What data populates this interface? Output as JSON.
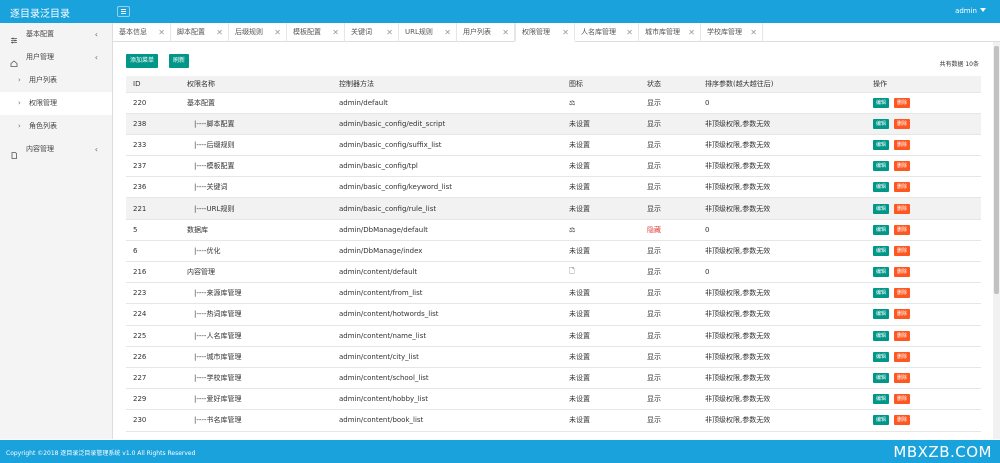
{
  "app": {
    "title": "逐目录泛目录",
    "user": "admin"
  },
  "sidebar": {
    "items": [
      {
        "label": "基本配置",
        "icon": "sliders-icon",
        "chev": "‹"
      },
      {
        "label": "用户管理",
        "icon": "home-icon",
        "chev": "‹"
      },
      {
        "label": "用户列表",
        "sub": true
      },
      {
        "label": "权限管理",
        "sub": true,
        "active": true
      },
      {
        "label": "角色列表",
        "sub": true
      },
      {
        "label": "内容管理",
        "icon": "document-icon",
        "chev": "‹"
      }
    ]
  },
  "tabs": [
    {
      "label": "基本信息",
      "close": "✕"
    },
    {
      "label": "脚本配置",
      "close": "✕"
    },
    {
      "label": "后缀规则",
      "close": "✕"
    },
    {
      "label": "模板配置",
      "close": "✕"
    },
    {
      "label": "关键词",
      "close": "✕"
    },
    {
      "label": "URL规则",
      "close": "✕"
    },
    {
      "label": "用户列表",
      "close": "✕"
    },
    {
      "label": "权限管理",
      "close": "✕",
      "active": true
    },
    {
      "label": "人名库管理",
      "close": "✕"
    },
    {
      "label": "城市库管理",
      "close": "✕"
    },
    {
      "label": "学校库管理",
      "close": "✕"
    }
  ],
  "toolbar": {
    "add_label": "添加菜单",
    "refresh_label": "刷新",
    "total": "共有数据 10条"
  },
  "table": {
    "headers": [
      "ID",
      "权限名称",
      "控制器方法",
      "图标",
      "状态",
      "排序参数(越大越往后)",
      "操作"
    ],
    "edit_label": "编辑",
    "delete_label": "删除",
    "rows": [
      {
        "id": "220",
        "name": "基本配置",
        "method": "admin/default",
        "icon": "⚖",
        "status": "显示",
        "sort": "0"
      },
      {
        "id": "238",
        "name": "|----脚本配置",
        "method": "admin/basic_config/edit_script",
        "icon": "未设置",
        "status": "显示",
        "sort": "非顶级权限,参数无效"
      },
      {
        "id": "233",
        "name": "|----后缀规则",
        "method": "admin/basic_config/suffix_list",
        "icon": "未设置",
        "status": "显示",
        "sort": "非顶级权限,参数无效"
      },
      {
        "id": "237",
        "name": "|----模板配置",
        "method": "admin/basic_config/tpl",
        "icon": "未设置",
        "status": "显示",
        "sort": "非顶级权限,参数无效"
      },
      {
        "id": "236",
        "name": "|----关键词",
        "method": "admin/basic_config/keyword_list",
        "icon": "未设置",
        "status": "显示",
        "sort": "非顶级权限,参数无效"
      },
      {
        "id": "221",
        "name": "|----URL规则",
        "method": "admin/basic_config/rule_list",
        "icon": "未设置",
        "status": "显示",
        "sort": "非顶级权限,参数无效"
      },
      {
        "id": "5",
        "name": "数据库",
        "method": "admin/DbManage/default",
        "icon": "⚖",
        "status": "隐藏",
        "sort": "0"
      },
      {
        "id": "6",
        "name": "|----优化",
        "method": "admin/DbManage/index",
        "icon": "未设置",
        "status": "显示",
        "sort": "非顶级权限,参数无效"
      },
      {
        "id": "216",
        "name": "内容管理",
        "method": "admin/content/default",
        "icon": "🗋",
        "status": "显示",
        "sort": "0"
      },
      {
        "id": "223",
        "name": "|----来源库管理",
        "method": "admin/content/from_list",
        "icon": "未设置",
        "status": "显示",
        "sort": "非顶级权限,参数无效"
      },
      {
        "id": "224",
        "name": "|----热词库管理",
        "method": "admin/content/hotwords_list",
        "icon": "未设置",
        "status": "显示",
        "sort": "非顶级权限,参数无效"
      },
      {
        "id": "225",
        "name": "|----人名库管理",
        "method": "admin/content/name_list",
        "icon": "未设置",
        "status": "显示",
        "sort": "非顶级权限,参数无效"
      },
      {
        "id": "226",
        "name": "|----城市库管理",
        "method": "admin/content/city_list",
        "icon": "未设置",
        "status": "显示",
        "sort": "非顶级权限,参数无效"
      },
      {
        "id": "227",
        "name": "|----学校库管理",
        "method": "admin/content/school_list",
        "icon": "未设置",
        "status": "显示",
        "sort": "非顶级权限,参数无效"
      },
      {
        "id": "229",
        "name": "|----爱好库管理",
        "method": "admin/content/hobby_list",
        "icon": "未设置",
        "status": "显示",
        "sort": "非顶级权限,参数无效"
      },
      {
        "id": "230",
        "name": "|----书名库管理",
        "method": "admin/content/book_list",
        "icon": "未设置",
        "status": "显示",
        "sort": "非顶级权限,参数无效"
      }
    ]
  },
  "footer": {
    "copyright": "Copyright ©2018 逐目录泛目录管理系统 v1.0 All Rights Reserved",
    "watermark": "MBXZB.COM"
  },
  "colors": {
    "primary": "#1aa2dc",
    "button": "#009688",
    "danger": "#ff5722",
    "hidden": "#e13e3e"
  }
}
